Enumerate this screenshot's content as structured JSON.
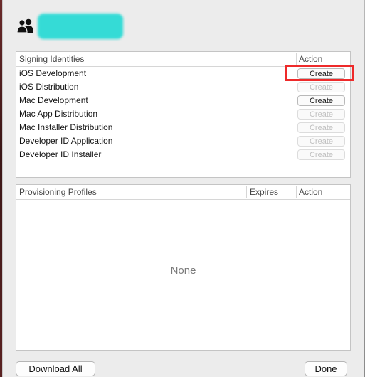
{
  "account": {
    "icon": "people-icon",
    "name": ""
  },
  "signing": {
    "columns": {
      "identity": "Signing Identities",
      "action": "Action"
    },
    "rows": [
      {
        "label": "iOS Development",
        "action": "Create",
        "enabled": true,
        "highlighted": true
      },
      {
        "label": "iOS Distribution",
        "action": "Create",
        "enabled": false
      },
      {
        "label": "Mac Development",
        "action": "Create",
        "enabled": true
      },
      {
        "label": "Mac App Distribution",
        "action": "Create",
        "enabled": false
      },
      {
        "label": "Mac Installer Distribution",
        "action": "Create",
        "enabled": false
      },
      {
        "label": "Developer ID Application",
        "action": "Create",
        "enabled": false
      },
      {
        "label": "Developer ID Installer",
        "action": "Create",
        "enabled": false
      }
    ]
  },
  "profiles": {
    "columns": {
      "name": "Provisioning Profiles",
      "expires": "Expires",
      "action": "Action"
    },
    "empty_text": "None"
  },
  "footer": {
    "download_all": "Download All",
    "done": "Done"
  },
  "colors": {
    "highlight": "#ee2a2a",
    "blurred_name": "#35dbd6"
  }
}
